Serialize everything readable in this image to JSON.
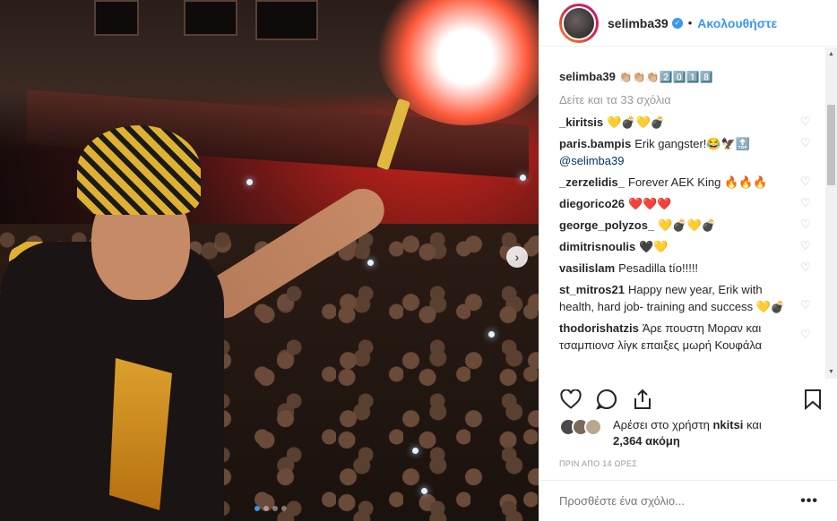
{
  "post": {
    "username": "selimba39",
    "follow_label": "Ακολουθήστε",
    "follow_separator": "•",
    "caption_text": "👏🏼👏🏼👏🏼2️⃣0️⃣1️⃣8️⃣",
    "view_all_comments": "Δείτε και τα 33 σχόλια",
    "carousel": {
      "total": 4,
      "current": 1
    }
  },
  "comments": [
    {
      "user": "_kiritsis",
      "text": "💛💣💛💣"
    },
    {
      "user": "paris.bampis",
      "text": "Erik gangster!😂🦅🔝",
      "mention": "@selimba39"
    },
    {
      "user": "_zerzelidis_",
      "text": "Forever AEK King 🔥🔥🔥"
    },
    {
      "user": "diegorico26",
      "text": "❤️❤️❤️"
    },
    {
      "user": "george_polyzos_",
      "text": "💛💣💛💣"
    },
    {
      "user": "dimitrisnoulis",
      "text": "🖤💛"
    },
    {
      "user": "vasilislam",
      "text": "Pesadilla tío!!!!!"
    },
    {
      "user": "st_mitros21",
      "text": "Happy new year, Erik with health, hard job- training and success 💛💣"
    },
    {
      "user": "thodorishatzis",
      "text": "Άρε πουστη Μοραν και τσαμπιονσ λίγκ επαιξες μωρή Κουφάλα"
    }
  ],
  "likes": {
    "prefix": "Αρέσει στο χρήστη",
    "user": "nkitsi",
    "middle": "και",
    "count": "2,364 ακόμη"
  },
  "timestamp": "ΠΡΙΝ ΑΠΟ 14 ΩΡΕΣ",
  "add_comment": {
    "placeholder": "Προσθέστε ένα σχόλιο..."
  },
  "colors": {
    "accent": "#3897f0",
    "muted": "#999999",
    "text": "#262626",
    "border": "#efefef"
  }
}
